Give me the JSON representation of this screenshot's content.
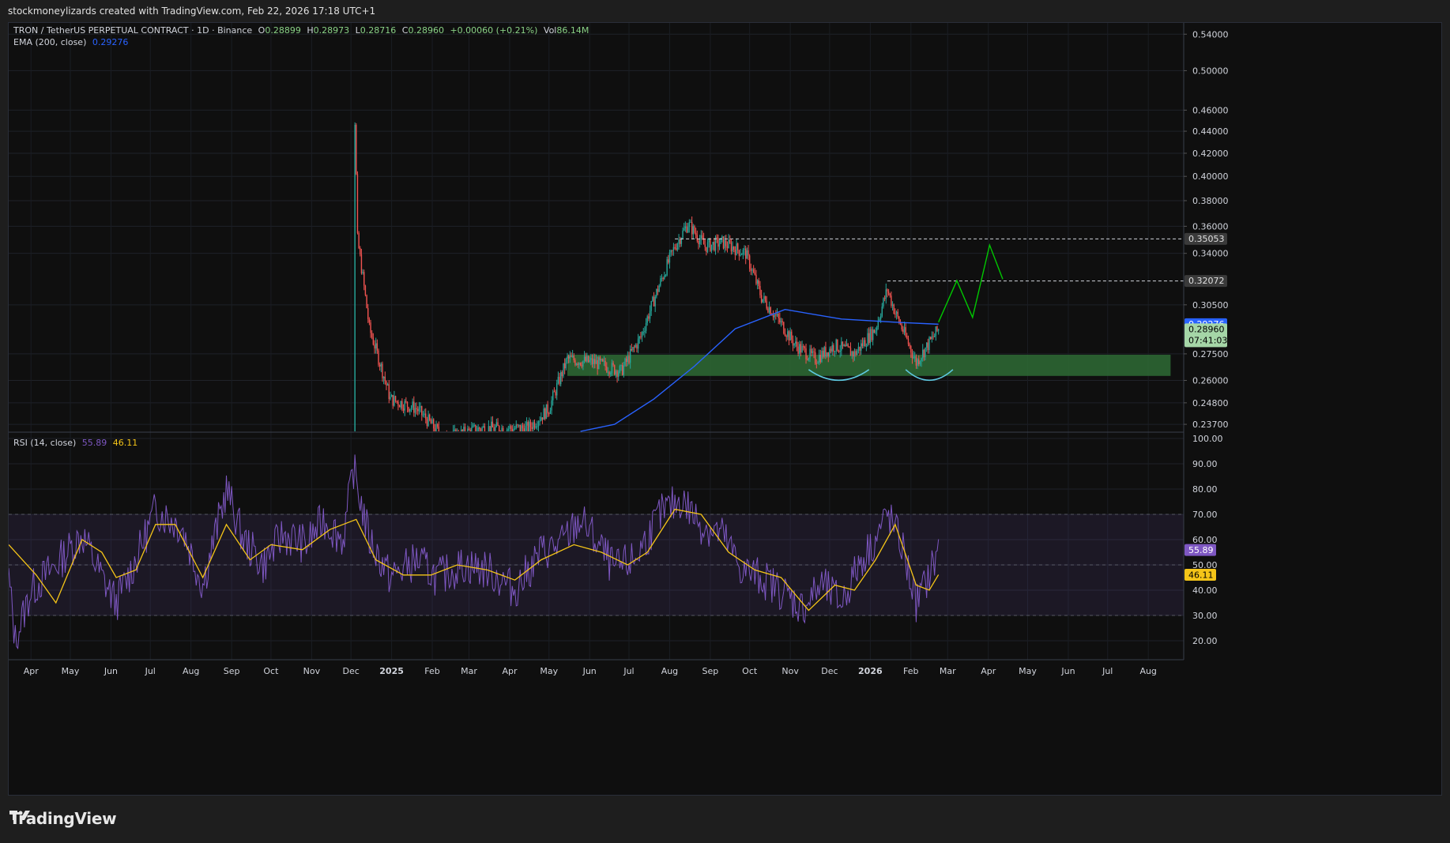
{
  "header": {
    "caption": "stockmoneylizards created with TradingView.com, Feb 22, 2026 17:18 UTC+1"
  },
  "legend": {
    "symbol": "TRON / TetherUS PERPETUAL CONTRACT · 1D · Binance",
    "open_label": "O",
    "open": "0.28899",
    "high_label": "H",
    "high": "0.28973",
    "low_label": "L",
    "low": "0.28716",
    "close_label": "C",
    "close": "0.28960",
    "change": "+0.00060 (+0.21%)",
    "vol_label": "Vol",
    "vol": "86.14M",
    "ema_label": "EMA (200, close)",
    "ema_value": "0.29276",
    "rsi_label": "RSI (14, close)",
    "rsi_value": "55.89",
    "rsi_ma_value": "46.11"
  },
  "brand": {
    "name": "TradingView",
    "icon": "tradingview-logo-icon"
  },
  "colors": {
    "bg": "#0f0f0f",
    "up": "#26a69a",
    "down": "#ef5350",
    "ema": "#2962ff",
    "rsi": "#7e57c2",
    "rsi_ma": "#f5c518",
    "zone": "#2e6b35",
    "arc": "#5ec8e0",
    "projection": "#00c800",
    "current": "#a5d6a7"
  },
  "chart_data": [
    {
      "type": "candlestick",
      "title": "TRON / TetherUS PERPETUAL CONTRACT · 1D · Binance",
      "scale": "log",
      "y_ticks": [
        "0.54000",
        "0.50000",
        "0.46000",
        "0.44000",
        "0.42000",
        "0.40000",
        "0.38000",
        "0.36000",
        "0.34000",
        "0.30500",
        "0.27500",
        "0.26000",
        "0.24800",
        "0.23700"
      ],
      "y_tick_values": [
        0.54,
        0.5,
        0.46,
        0.44,
        0.42,
        0.4,
        0.38,
        0.36,
        0.34,
        0.305,
        0.275,
        0.26,
        0.248,
        0.237
      ],
      "x_ticks": [
        "Apr",
        "May",
        "Jun",
        "Jul",
        "Aug",
        "Sep",
        "Oct",
        "Nov",
        "Dec",
        "2025",
        "Feb",
        "Mar",
        "Apr",
        "May",
        "Jun",
        "Jul",
        "Aug",
        "Sep",
        "Oct",
        "Nov",
        "Dec",
        "2026",
        "Feb",
        "Mar",
        "Apr",
        "May",
        "Jun",
        "Jul",
        "Aug"
      ],
      "price_path": [
        [
          "2024-11-25",
          0.2
        ],
        [
          "2024-12-03",
          0.2
        ],
        [
          "2024-12-04",
          0.45
        ],
        [
          "2024-12-06",
          0.35
        ],
        [
          "2024-12-15",
          0.29
        ],
        [
          "2024-12-31",
          0.25
        ],
        [
          "2025-01-20",
          0.245
        ],
        [
          "2025-02-10",
          0.23
        ],
        [
          "2025-03-10",
          0.235
        ],
        [
          "2025-04-15",
          0.235
        ],
        [
          "2025-05-01",
          0.245
        ],
        [
          "2025-05-15",
          0.272
        ],
        [
          "2025-06-05",
          0.27
        ],
        [
          "2025-06-25",
          0.265
        ],
        [
          "2025-07-10",
          0.285
        ],
        [
          "2025-07-25",
          0.32
        ],
        [
          "2025-08-05",
          0.345
        ],
        [
          "2025-08-15",
          0.362
        ],
        [
          "2025-08-28",
          0.345
        ],
        [
          "2025-09-10",
          0.348
        ],
        [
          "2025-09-28",
          0.34
        ],
        [
          "2025-10-10",
          0.31
        ],
        [
          "2025-10-25",
          0.293
        ],
        [
          "2025-11-05",
          0.28
        ],
        [
          "2025-11-20",
          0.272
        ],
        [
          "2025-12-05",
          0.28
        ],
        [
          "2025-12-20",
          0.275
        ],
        [
          "2026-01-05",
          0.29
        ],
        [
          "2026-01-14",
          0.315
        ],
        [
          "2026-01-20",
          0.3
        ],
        [
          "2026-02-05",
          0.27
        ],
        [
          "2026-02-12",
          0.278
        ],
        [
          "2026-02-22",
          0.2896
        ]
      ],
      "ema200_path": [
        [
          "2025-05-25",
          0.225
        ],
        [
          "2025-06-20",
          0.237
        ],
        [
          "2025-07-20",
          0.25
        ],
        [
          "2025-08-20",
          0.268
        ],
        [
          "2025-09-20",
          0.29
        ],
        [
          "2025-10-28",
          0.302
        ],
        [
          "2025-12-10",
          0.296
        ],
        [
          "2026-01-20",
          0.294
        ],
        [
          "2026-02-22",
          0.29276
        ]
      ],
      "horizontal_levels": [
        {
          "start": "2025-08-05",
          "price": 0.35053,
          "label": "0.35053"
        },
        {
          "start": "2026-01-14",
          "price": 0.32072,
          "label": "0.32072"
        }
      ],
      "support_zone": {
        "from": "2025-05-15",
        "to": "2026-08-18",
        "low": 0.2625,
        "high": 0.2745
      },
      "arcs": [
        {
          "from": "2025-11-15",
          "to": "2025-12-31"
        },
        {
          "from": "2026-01-28",
          "to": "2026-03-05"
        }
      ],
      "projection": [
        [
          "2026-02-22",
          0.294
        ],
        [
          "2026-03-08",
          0.321
        ],
        [
          "2026-03-20",
          0.297
        ],
        [
          "2026-04-02",
          0.346
        ],
        [
          "2026-04-12",
          0.322
        ]
      ],
      "price_labels": [
        {
          "label": "0.35053",
          "price": 0.35053,
          "kind": "level"
        },
        {
          "label": "0.32072",
          "price": 0.32072,
          "kind": "level"
        },
        {
          "label": "0.29276",
          "price": 0.29276,
          "kind": "ema"
        },
        {
          "label": "0.28960",
          "sub": "07:41:03",
          "price": 0.2896,
          "kind": "current"
        }
      ]
    },
    {
      "type": "line",
      "title": "RSI (14, close)",
      "y_ticks": [
        "100.00",
        "90.00",
        "80.00",
        "70.00",
        "60.00",
        "50.00",
        "40.00",
        "30.00",
        "20.00"
      ],
      "y_tick_values": [
        100,
        90,
        80,
        70,
        60,
        50,
        40,
        30,
        20
      ],
      "ylim": [
        15,
        100
      ],
      "overbought": 70,
      "midline": 50,
      "oversold": 30,
      "rsi_path": [
        [
          "2024-03-15",
          45
        ],
        [
          "2024-03-20",
          20
        ],
        [
          "2024-04-01",
          40
        ],
        [
          "2024-04-20",
          50
        ],
        [
          "2024-05-10",
          62
        ],
        [
          "2024-05-25",
          45
        ],
        [
          "2024-06-05",
          35
        ],
        [
          "2024-06-20",
          52
        ],
        [
          "2024-07-05",
          72
        ],
        [
          "2024-07-25",
          65
        ],
        [
          "2024-08-10",
          42
        ],
        [
          "2024-08-28",
          80
        ],
        [
          "2024-09-10",
          60
        ],
        [
          "2024-09-25",
          50
        ],
        [
          "2024-10-10",
          62
        ],
        [
          "2024-10-28",
          58
        ],
        [
          "2024-11-10",
          68
        ],
        [
          "2024-11-25",
          60
        ],
        [
          "2024-12-03",
          88
        ],
        [
          "2024-12-15",
          60
        ],
        [
          "2024-12-31",
          45
        ],
        [
          "2025-01-20",
          52
        ],
        [
          "2025-02-05",
          45
        ],
        [
          "2025-02-25",
          50
        ],
        [
          "2025-03-15",
          48
        ],
        [
          "2025-04-05",
          40
        ],
        [
          "2025-04-25",
          55
        ],
        [
          "2025-05-10",
          58
        ],
        [
          "2025-05-25",
          68
        ],
        [
          "2025-06-05",
          60
        ],
        [
          "2025-06-20",
          48
        ],
        [
          "2025-07-05",
          52
        ],
        [
          "2025-07-25",
          70
        ],
        [
          "2025-08-10",
          76
        ],
        [
          "2025-08-25",
          66
        ],
        [
          "2025-09-10",
          62
        ],
        [
          "2025-09-25",
          48
        ],
        [
          "2025-10-10",
          45
        ],
        [
          "2025-10-25",
          40
        ],
        [
          "2025-11-10",
          33
        ],
        [
          "2025-11-25",
          42
        ],
        [
          "2025-12-10",
          35
        ],
        [
          "2025-12-25",
          52
        ],
        [
          "2026-01-05",
          60
        ],
        [
          "2026-01-14",
          70
        ],
        [
          "2026-01-25",
          58
        ],
        [
          "2026-02-05",
          35
        ],
        [
          "2026-02-12",
          42
        ],
        [
          "2026-02-22",
          55.89
        ]
      ],
      "rsi_ma_path": [
        [
          "2024-03-15",
          58
        ],
        [
          "2024-04-05",
          46
        ],
        [
          "2024-04-20",
          35
        ],
        [
          "2024-05-10",
          60
        ],
        [
          "2024-05-25",
          55
        ],
        [
          "2024-06-05",
          45
        ],
        [
          "2024-06-20",
          48
        ],
        [
          "2024-07-05",
          66
        ],
        [
          "2024-07-20",
          66
        ],
        [
          "2024-08-10",
          45
        ],
        [
          "2024-08-28",
          66
        ],
        [
          "2024-09-15",
          52
        ],
        [
          "2024-10-01",
          58
        ],
        [
          "2024-10-25",
          56
        ],
        [
          "2024-11-15",
          64
        ],
        [
          "2024-12-05",
          68
        ],
        [
          "2024-12-20",
          52
        ],
        [
          "2025-01-10",
          46
        ],
        [
          "2025-01-31",
          46
        ],
        [
          "2025-02-20",
          50
        ],
        [
          "2025-03-15",
          48
        ],
        [
          "2025-04-05",
          44
        ],
        [
          "2025-04-25",
          52
        ],
        [
          "2025-05-20",
          58
        ],
        [
          "2025-06-10",
          55
        ],
        [
          "2025-06-30",
          50
        ],
        [
          "2025-07-15",
          55
        ],
        [
          "2025-08-05",
          72
        ],
        [
          "2025-08-25",
          70
        ],
        [
          "2025-09-15",
          55
        ],
        [
          "2025-10-05",
          48
        ],
        [
          "2025-10-25",
          45
        ],
        [
          "2025-11-15",
          32
        ],
        [
          "2025-12-05",
          42
        ],
        [
          "2025-12-20",
          40
        ],
        [
          "2026-01-05",
          52
        ],
        [
          "2026-01-20",
          66
        ],
        [
          "2026-02-05",
          42
        ],
        [
          "2026-02-15",
          40
        ],
        [
          "2026-02-22",
          46.11
        ]
      ],
      "value_labels": [
        {
          "label": "55.89",
          "value": 55.89,
          "kind": "rsi"
        },
        {
          "label": "46.11",
          "value": 46.11,
          "kind": "ma"
        }
      ]
    }
  ]
}
